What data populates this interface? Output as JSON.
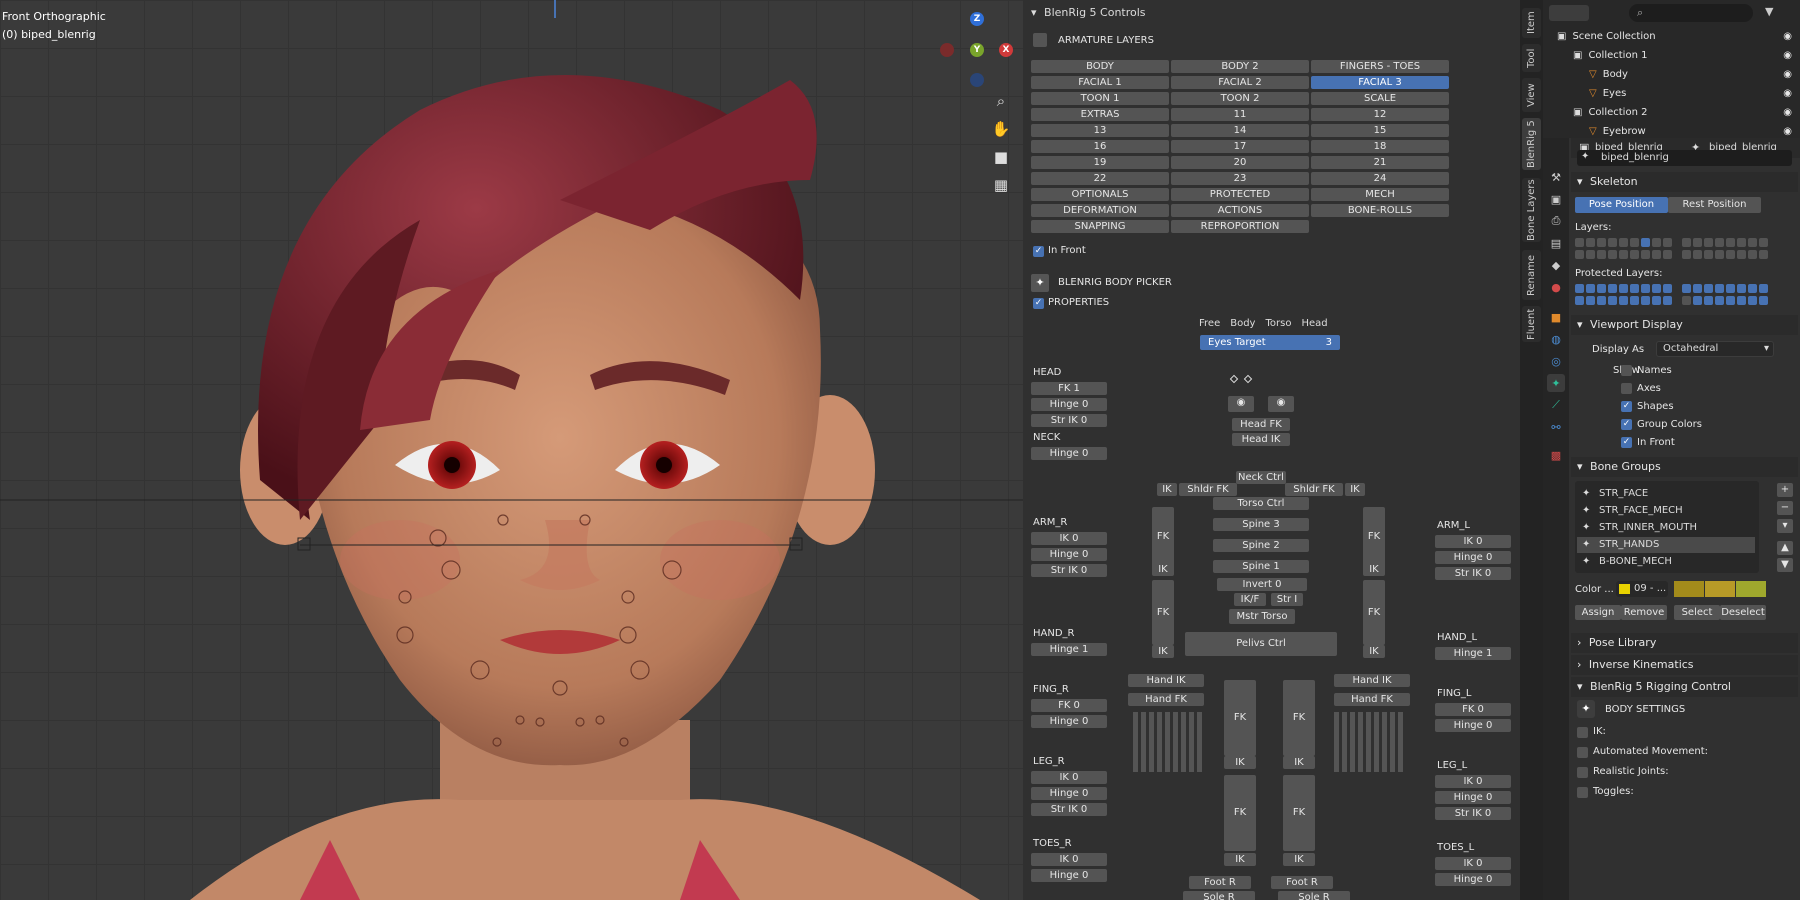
{
  "viewport": {
    "mode_label": "Front Orthographic",
    "object_label": "(0) biped_blenrig",
    "axes": {
      "z": "Z",
      "y": "Y",
      "x": "X"
    }
  },
  "npanel": {
    "title": "BlenRig 5 Controls",
    "armature_layers_label": "ARMATURE LAYERS",
    "layer_buttons": [
      [
        "BODY",
        "BODY 2",
        "FINGERS - TOES"
      ],
      [
        "FACIAL 1",
        "FACIAL 2",
        "FACIAL 3"
      ],
      [
        "TOON 1",
        "TOON 2",
        "SCALE"
      ],
      [
        "EXTRAS",
        "11",
        "12"
      ],
      [
        "13",
        "14",
        "15"
      ],
      [
        "16",
        "17",
        "18"
      ],
      [
        "19",
        "20",
        "21"
      ],
      [
        "22",
        "23",
        "24"
      ],
      [
        "OPTIONALS",
        "PROTECTED",
        "MECH"
      ],
      [
        "DEFORMATION",
        "ACTIONS",
        "BONE-ROLLS"
      ],
      [
        "SNAPPING",
        "REPROPORTION",
        ""
      ]
    ],
    "active_layer": "FACIAL 3",
    "in_front_label": "In Front",
    "body_picker_label": "BLENRIG BODY PICKER",
    "properties_label": "PROPERTIES",
    "picker_tabs": [
      "Free",
      "Body",
      "Torso",
      "Head"
    ],
    "eyes_target": {
      "label": "Eyes Target",
      "value": "3"
    },
    "left_props": [
      {
        "section": "HEAD",
        "items": [
          "FK 1",
          "Hinge 0",
          "Str IK 0"
        ]
      },
      {
        "section": "NECK",
        "items": [
          "Hinge 0"
        ]
      },
      {
        "section": "ARM_R",
        "items": [
          "IK 0",
          "Hinge 0",
          "Str IK 0"
        ]
      },
      {
        "section": "HAND_R",
        "items": [
          "Hinge 1"
        ]
      },
      {
        "section": "FING_R",
        "items": [
          "FK 0",
          "Hinge 0"
        ]
      },
      {
        "section": "LEG_R",
        "items": [
          "IK 0",
          "Hinge 0",
          "Str IK 0"
        ]
      },
      {
        "section": "TOES_R",
        "items": [
          "IK 0",
          "Hinge 0"
        ]
      }
    ],
    "right_props": [
      {
        "section": "ARM_L",
        "items": [
          "IK 0",
          "Hinge 0",
          "Str IK 0"
        ]
      },
      {
        "section": "HAND_L",
        "items": [
          "Hinge 1"
        ]
      },
      {
        "section": "FING_L",
        "items": [
          "FK 0",
          "Hinge 0"
        ]
      },
      {
        "section": "LEG_L",
        "items": [
          "IK 0",
          "Hinge 0",
          "Str IK 0"
        ]
      },
      {
        "section": "TOES_L",
        "items": [
          "IK 0",
          "Hinge 0"
        ]
      }
    ],
    "picker": {
      "head_fk": "Head FK",
      "head_ik": "Head IK",
      "neck_ctrl": "Neck Ctrl",
      "shldr_fk_l": "Shldr FK",
      "shldr_fk_r": "Shldr FK",
      "ik": "IK",
      "fk": "FK",
      "torso_ctrl": "Torso Ctrl",
      "spine3": "Spine 3",
      "spine2": "Spine 2",
      "spine1": "Spine 1",
      "invert": "Invert 0",
      "ikf": "IK/F",
      "str_i": "Str I",
      "mstr_torso": "Mstr Torso",
      "pelvis": "Pelivs Ctrl",
      "hand_ik": "Hand IK",
      "hand_fk": "Hand FK",
      "foot_r": "Foot R",
      "sole_r": "Sole R"
    }
  },
  "vtabs": [
    "Item",
    "Tool",
    "View",
    "BlenRig 5",
    "Bone Layers",
    "Rename",
    "Fluent"
  ],
  "outliner": {
    "search_placeholder": "",
    "rows": [
      {
        "label": "Scene Collection",
        "indent": 0
      },
      {
        "label": "Collection 1",
        "indent": 1
      },
      {
        "label": "Body",
        "indent": 2
      },
      {
        "label": "Eyes",
        "indent": 2
      },
      {
        "label": "Collection 2",
        "indent": 1
      },
      {
        "label": "Eyebrow",
        "indent": 2
      }
    ]
  },
  "properties": {
    "header_left": "biped_blenrig",
    "header_right": "biped_blenrig",
    "data_name": "biped_blenrig",
    "skeleton_label": "Skeleton",
    "pose_position": "Pose Position",
    "rest_position": "Rest Position",
    "layers_label": "Layers:",
    "protected_layers_label": "Protected Layers:",
    "viewport_display": "Viewport Display",
    "display_as_label": "Display As",
    "display_as_value": "Octahedral",
    "show_label": "Show",
    "show_items": [
      {
        "label": "Names",
        "checked": false
      },
      {
        "label": "Axes",
        "checked": false
      },
      {
        "label": "Shapes",
        "checked": true
      },
      {
        "label": "Group Colors",
        "checked": true
      },
      {
        "label": "In Front",
        "checked": true
      }
    ],
    "bone_groups_label": "Bone Groups",
    "bone_groups": [
      "STR_FACE",
      "STR_FACE_MECH",
      "STR_INNER_MOUTH",
      "STR_HANDS",
      "B-BONE_MECH"
    ],
    "selected_group": "STR_HANDS",
    "color_label": "Color ...",
    "color_value": "09 - ...",
    "assign": "Assign",
    "remove": "Remove",
    "select": "Select",
    "deselect": "Deselect",
    "pose_library": "Pose Library",
    "inverse_kinematics": "Inverse Kinematics",
    "rigging_control": "BlenRig 5 Rigging Control",
    "body_settings": "BODY SETTINGS",
    "body_settings_items": [
      "IK:",
      "Automated Movement:",
      "Realistic Joints:",
      "Toggles:"
    ]
  }
}
